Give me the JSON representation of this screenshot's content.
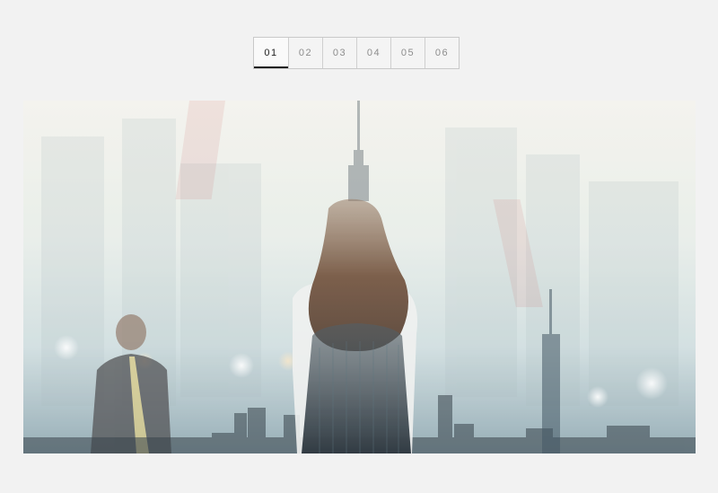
{
  "pagination": {
    "active_index": 0,
    "tabs": [
      {
        "label": "01"
      },
      {
        "label": "02"
      },
      {
        "label": "03"
      },
      {
        "label": "04"
      },
      {
        "label": "05"
      },
      {
        "label": "06"
      }
    ]
  },
  "hero": {
    "image": "double-exposure-city-photo",
    "palette": {
      "sky": "#f1f0ea",
      "mist": "#d7e3e3",
      "haze": "#8fa9b3",
      "hair": "#6b4a34",
      "building": "#1f2a30"
    }
  }
}
